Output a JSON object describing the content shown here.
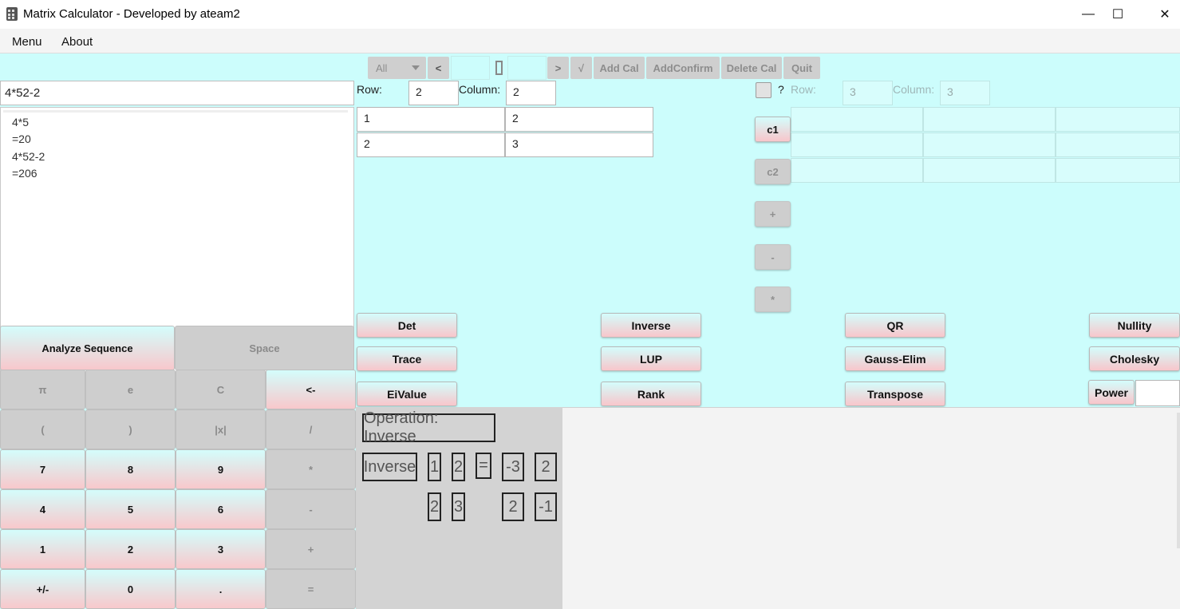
{
  "window": {
    "title": "Matrix Calculator - Developed by ateam2",
    "minimize": "—",
    "maximize": "☐",
    "close": "✕"
  },
  "menu": {
    "items": [
      "Menu",
      "About"
    ]
  },
  "toolbar": {
    "select": "All",
    "prev": "<",
    "sep": "|",
    "next": ">",
    "sqrt": "√",
    "add_cal": "Add Cal",
    "add_confirm": "AddConfirm",
    "delete_cal": "Delete Cal",
    "quit": "Quit"
  },
  "expression": "4*52-2",
  "history": [
    "4*5",
    "=20",
    "4*52-2",
    "=206"
  ],
  "keypad": {
    "analyze": "Analyze Sequence",
    "space": "Space",
    "pi": "π",
    "e": "e",
    "clear": "C",
    "backspace": "<-",
    "lparen": "(",
    "rparen": ")",
    "abs": "|x|",
    "divide": "/",
    "k7": "7",
    "k8": "8",
    "k9": "9",
    "multiply": "*",
    "k4": "4",
    "k5": "5",
    "k6": "6",
    "minus": "-",
    "k1": "1",
    "k2": "2",
    "k3": "3",
    "plus": "+",
    "negate": "+/-",
    "k0": "0",
    "dot": ".",
    "equals": "="
  },
  "matrix1": {
    "row_label": "Row:",
    "rows": "2",
    "col_label": "Column:",
    "cols": "2",
    "cells": [
      [
        "1",
        "2"
      ],
      [
        "2",
        "3"
      ]
    ]
  },
  "matrix2": {
    "check_label": "?",
    "row_label": "Row:",
    "rows": "3",
    "col_label": "Column:",
    "cols": "3"
  },
  "side_buttons": {
    "c1": "c1",
    "c2": "c2",
    "plus": "+",
    "minus": "-",
    "times": "*"
  },
  "ops": {
    "det": "Det",
    "inverse": "Inverse",
    "qr": "QR",
    "nullity": "Nullity",
    "trace": "Trace",
    "lup": "LUP",
    "gauss": "Gauss-Elim",
    "cholesky": "Cholesky",
    "eivalue": "EiValue",
    "rank": "Rank",
    "transpose": "Transpose",
    "power": "Power"
  },
  "result": {
    "operation": "Operation: Inverse",
    "op_name": "Inverse",
    "input": [
      [
        "1",
        "2"
      ],
      [
        "2",
        "3"
      ]
    ],
    "equals": "=",
    "output": [
      [
        "-3",
        "2"
      ],
      [
        "2",
        "-1"
      ]
    ]
  }
}
